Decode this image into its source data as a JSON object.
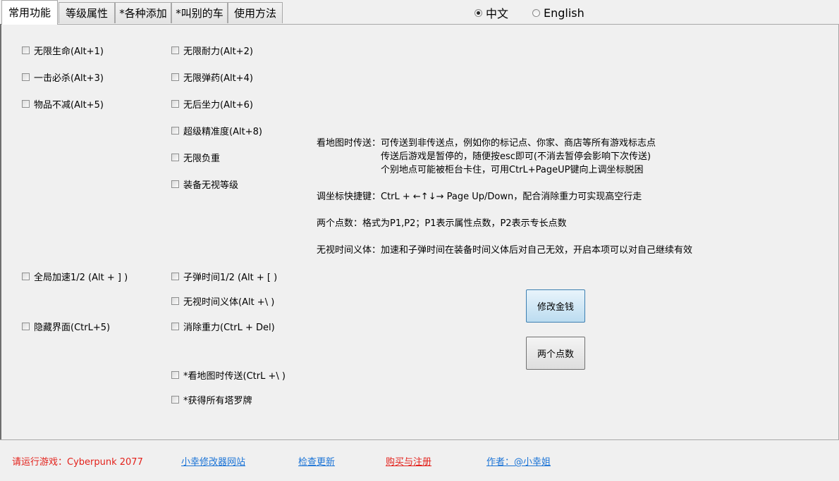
{
  "tabs": [
    {
      "label": "常用功能",
      "active": true
    },
    {
      "label": "等级属性",
      "active": false
    },
    {
      "label": "*各种添加",
      "active": false
    },
    {
      "label": "*叫别的车",
      "active": false
    },
    {
      "label": "使用方法",
      "active": false
    }
  ],
  "language": {
    "options": [
      "中文",
      "English"
    ],
    "selected": "中文"
  },
  "cheats": {
    "col1": [
      {
        "label": "无限生命(Alt+1)",
        "checked": false
      },
      {
        "label": "一击必杀(Alt+3)",
        "checked": false
      },
      {
        "label": "物品不减(Alt+5)",
        "checked": false
      },
      {
        "label": "全局加速1/2 (Alt + ] )",
        "checked": false
      },
      {
        "label": "隐藏界面(CtrL+5)",
        "checked": false
      }
    ],
    "col2": [
      {
        "label": "无限耐力(Alt+2)",
        "checked": false
      },
      {
        "label": "无限弹药(Alt+4)",
        "checked": false
      },
      {
        "label": "无后坐力(Alt+6)",
        "checked": false
      },
      {
        "label": "超级精准度(Alt+8)",
        "checked": false
      },
      {
        "label": "无限负重",
        "checked": false
      },
      {
        "label": "装备无视等级",
        "checked": false
      },
      {
        "label": "子弹时间1/2 (Alt + [ )",
        "checked": false
      },
      {
        "label": "无视时间义体(Alt +\\ )",
        "checked": false
      },
      {
        "label": "消除重力(CtrL + Del)",
        "checked": false
      },
      {
        "label": "*看地图时传送(CtrL +\\ )",
        "checked": false
      },
      {
        "label": "*获得所有塔罗牌",
        "checked": false
      }
    ]
  },
  "info": {
    "teleport_title": "看地图时传送：",
    "teleport_line1": "可传送到非传送点，例如你的标记点、你家、商店等所有游戏标志点",
    "teleport_line2": "传送后游戏是暂停的，随便按esc即可(不消去暂停会影响下次传送)",
    "teleport_line3": "个别地点可能被柜台卡住，可用CtrL+PageUP键向上调坐标脱困",
    "coords": "调坐标快捷键：CtrL + ←↑↓→ Page Up/Down，配合消除重力可实现高空行走",
    "points": "两个点数：格式为P1,P2；P1表示属性点数，P2表示专长点数",
    "cyberware": "无视时间义体：加速和子弹时间在装备时间义体后对自己无效，开启本项可以对自己继续有效"
  },
  "buttons": {
    "money": "修改金钱",
    "points": "两个点数"
  },
  "footer": {
    "status": "请运行游戏：Cyberpunk 2077",
    "website": "小幸修改器网站",
    "update": "检查更新",
    "buy": "购买与注册",
    "author": "作者：@小幸姐"
  },
  "colors": {
    "status_red": "#e3211b",
    "link_blue": "#1a73d6",
    "buy_red": "#e3211b"
  }
}
